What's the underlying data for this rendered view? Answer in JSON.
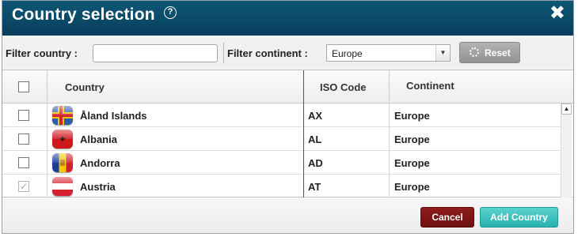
{
  "dialog": {
    "title": "Country selection",
    "help_glyph": "?",
    "close_glyph": "✖"
  },
  "filters": {
    "country_label": "Filter country :",
    "country_value": "",
    "continent_label": "Filter continent :",
    "continent_selected": "Europe",
    "reset_label": "Reset"
  },
  "table": {
    "headers": {
      "country": "Country",
      "iso": "ISO Code",
      "continent": "Continent"
    },
    "rows": [
      {
        "checked": false,
        "flag": "aland-flag",
        "country": "Åland Islands",
        "iso": "AX",
        "continent": "Europe"
      },
      {
        "checked": false,
        "flag": "albania-flag",
        "country": "Albania",
        "iso": "AL",
        "continent": "Europe"
      },
      {
        "checked": false,
        "flag": "andorra-flag",
        "country": "Andorra",
        "iso": "AD",
        "continent": "Europe"
      },
      {
        "checked": true,
        "flag": "austria-flag",
        "country": "Austria",
        "iso": "AT",
        "continent": "Europe"
      }
    ]
  },
  "footer": {
    "cancel_label": "Cancel",
    "add_label": "Add Country"
  },
  "colors": {
    "titlebar": "#0a4a69",
    "cancel": "#7a1414",
    "add": "#35bcb9",
    "reset": "#a0a0a0"
  }
}
